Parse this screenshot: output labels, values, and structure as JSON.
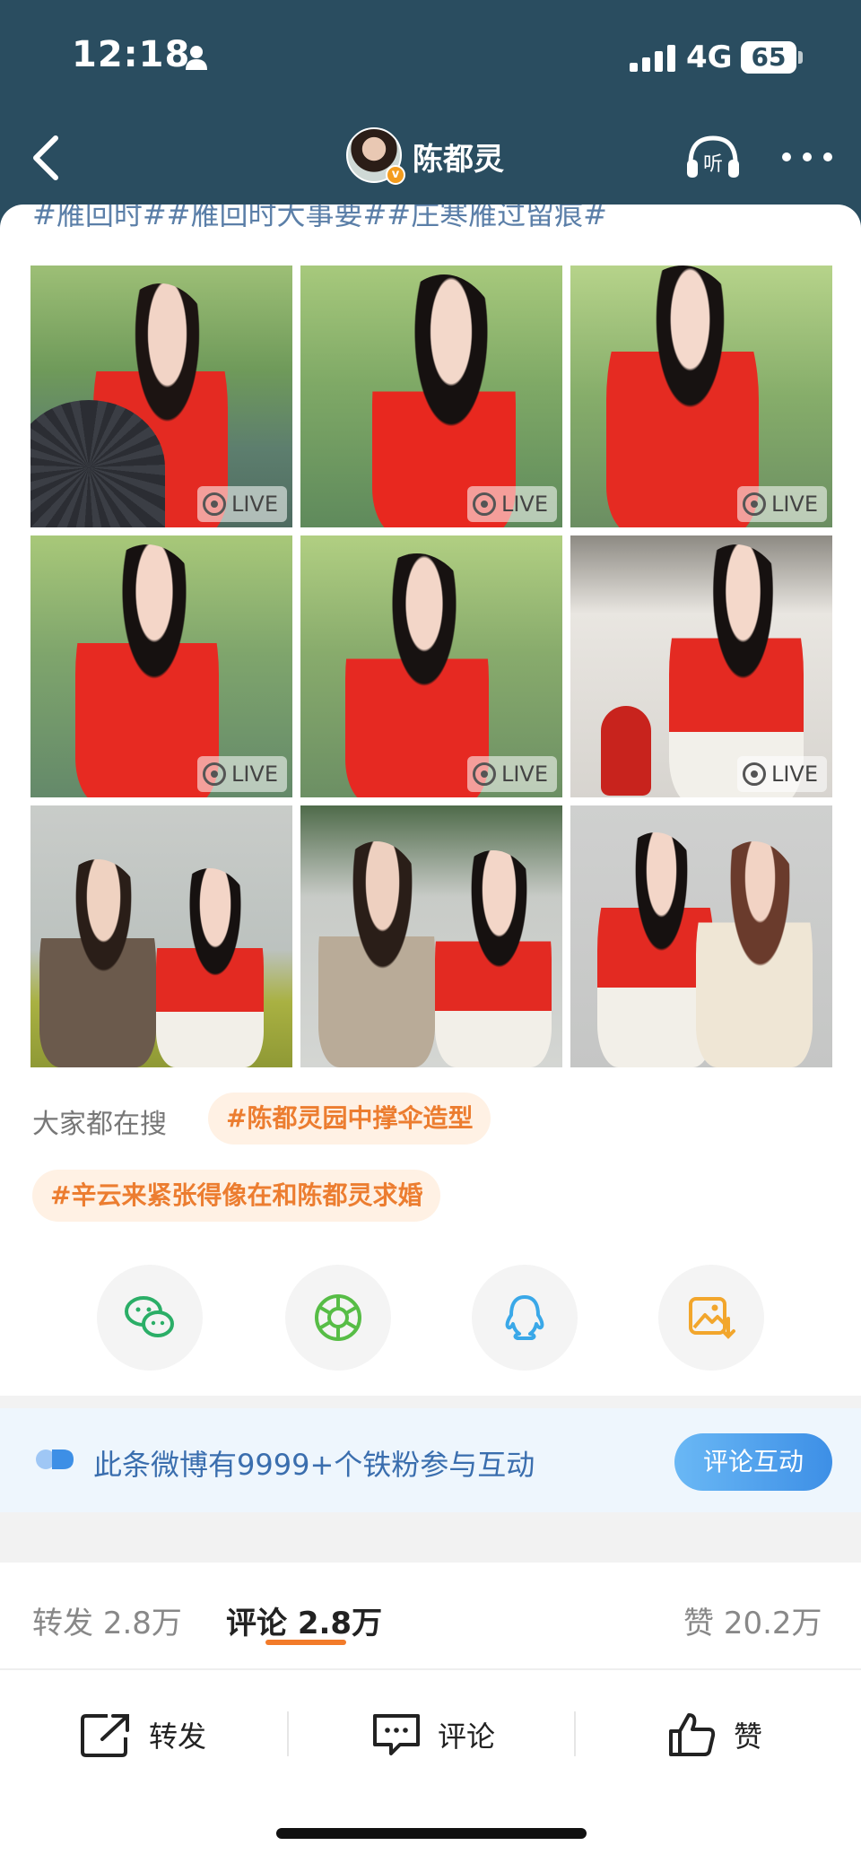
{
  "status_bar": {
    "time": "12:18",
    "network": "4G",
    "battery": "65"
  },
  "nav": {
    "title": "陈都灵",
    "verified_badge": "v",
    "listen_label": "听"
  },
  "post": {
    "hashtags_line": "#雁回时##雁回时大事要##庄寒雁过留痕#",
    "live_label": "LIVE"
  },
  "search": {
    "label": "大家都在搜",
    "tags": [
      "#陈都灵园中撑伞造型",
      "#辛云来紧张得像在和陈都灵求婚"
    ]
  },
  "share": {
    "icons": [
      "wechat-icon",
      "moments-icon",
      "qq-icon",
      "save-image-icon"
    ],
    "colors": {
      "wechat": "#2bae67",
      "moments": "#57bd46",
      "qq": "#3aa8e8",
      "save": "#f2a62c"
    }
  },
  "iron_fans": {
    "text": "此条微博有9999+个铁粉参与互动",
    "button": "评论互动"
  },
  "tabs": {
    "repost_label": "转发",
    "repost_count": "2.8万",
    "comment_label": "评论",
    "comment_count": "2.8万",
    "like_label": "赞",
    "like_count": "20.2万"
  },
  "actions": {
    "repost": "转发",
    "comment": "评论",
    "like": "赞"
  },
  "colors": {
    "header_bg": "#2a4d60",
    "accent_orange": "#f27b2a",
    "link_blue": "#5b7fa8"
  }
}
